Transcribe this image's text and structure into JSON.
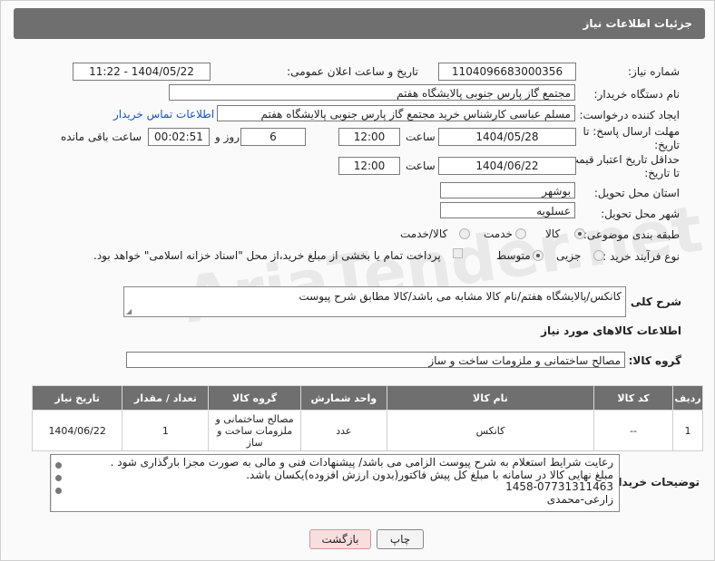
{
  "header": {
    "title": "جزئیات اطلاعات نیاز"
  },
  "fields": {
    "need_number_label": "شماره نیاز:",
    "need_number": "1104096683000356",
    "announce_label": "تاریخ و ساعت اعلان عمومی:",
    "announce_value": "1404/05/22 - 11:22",
    "buyer_org_label": "نام دستگاه خریدار:",
    "buyer_org": "مجتمع گاز پارس جنوبی  پالایشگاه هفتم",
    "requester_label": "ایجاد کننده درخواست:",
    "requester": "مسلم عباسی کارشناس خرید مجتمع گاز پارس جنوبی  پالایشگاه هفتم",
    "contact_link": "اطلاعات تماس خریدار",
    "deadline_label_1": "مهلت ارسال پاسخ: تا",
    "deadline_label_2": "تاریخ:",
    "deadline_date": "1404/05/28",
    "time_label": "ساعت",
    "deadline_time": "12:00",
    "days_value": "6",
    "days_label": "روز و",
    "remaining_value": "00:02:51",
    "remaining_label": "ساعت باقی مانده",
    "validity_label_1": "حداقل تاریخ اعتبار قیمت:",
    "validity_label_2": "تا تاریخ:",
    "validity_date": "1404/06/22",
    "validity_time": "12:00",
    "province_label": "استان محل تحویل:",
    "province": "بوشهر",
    "city_label": "شهر محل تحویل:",
    "city": "عسلویه",
    "category_label": "طبقه بندی موضوعی:",
    "category_options": [
      "کالا",
      "خدمت",
      "کالا/خدمت"
    ],
    "process_label": "نوع فرآیند خرید :",
    "process_options": [
      "جزیی",
      "متوسط"
    ],
    "payment_note": "پرداخت تمام یا بخشی از مبلغ خرید،از محل \"اسناد خزانه اسلامی\" خواهد بود.",
    "summary_label": "شرح کلی نیاز:",
    "summary": "کانکس/پالایشگاه هفتم/نام کالا مشابه می باشد/کالا مطابق شرح پیوست",
    "goods_info_title": "اطلاعات کالاهای مورد نیاز",
    "goods_group_label": "گروه کالا:",
    "goods_group": "مصالح ساختمانی و ملزومات ساخت و ساز"
  },
  "table": {
    "headers": [
      "ردیف",
      "کد کالا",
      "نام کالا",
      "واحد شمارش",
      "گروه کالا",
      "تعداد / مقدار",
      "تاریخ نیاز"
    ],
    "rows": [
      [
        "1",
        "--",
        "کانکس",
        "عدد",
        "مصالح ساختمانی و ملزومات ساخت و ساز",
        "1",
        "1404/06/22"
      ]
    ]
  },
  "notes": {
    "label": "توضیحات خریدار:",
    "lines": [
      "رعایت شرایط استعلام به شرح پیوست الزامی می باشد/ پیشنهادات فنی و مالی به صورت مجزا بارگذاری شود .",
      "مبلغ نهایی کالا در سامانه با مبلغ کل پیش فاکتور(بدون ارزش افزوده)یکسان باشد.",
      "1458-07731311463",
      "زارعی-محمدی"
    ]
  },
  "buttons": {
    "print": "چاپ",
    "back": "بازگشت"
  },
  "colors": {
    "header_bg": "#6f6f6f",
    "link": "#1a57b8",
    "back_btn": "#f9dede"
  }
}
